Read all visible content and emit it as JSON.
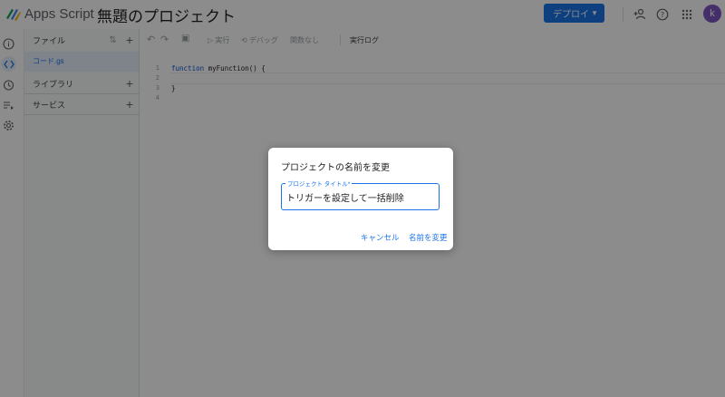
{
  "header": {
    "app_name": "Apps Script",
    "project_title": "無題のプロジェクト",
    "deploy_label": "デプロイ",
    "avatar_letter": "k"
  },
  "file_panel": {
    "files_heading": "ファイル",
    "files": [
      {
        "name": "コード.gs"
      }
    ],
    "libraries_label": "ライブラリ",
    "services_label": "サービス"
  },
  "toolbar": {
    "run_label": "実行",
    "debug_label": "デバッグ",
    "function_select": "関数なし",
    "log_label": "実行ログ"
  },
  "editor": {
    "line_numbers": [
      "1",
      "2",
      "3",
      "4"
    ],
    "lines": [
      {
        "keyword": "function",
        "rest": " myFunction() {"
      },
      {
        "keyword": "",
        "rest": ""
      },
      {
        "keyword": "",
        "rest": "}"
      },
      {
        "keyword": "",
        "rest": ""
      }
    ]
  },
  "dialog": {
    "title": "プロジェクトの名前を変更",
    "field_label": "プロジェクト タイトル*",
    "field_value": "トリガーを設定して一括削除",
    "cancel_label": "キャンセル",
    "rename_label": "名前を変更"
  },
  "colors": {
    "accent": "#1a73e8",
    "overlay": "rgba(0,0,0,0.45)"
  }
}
